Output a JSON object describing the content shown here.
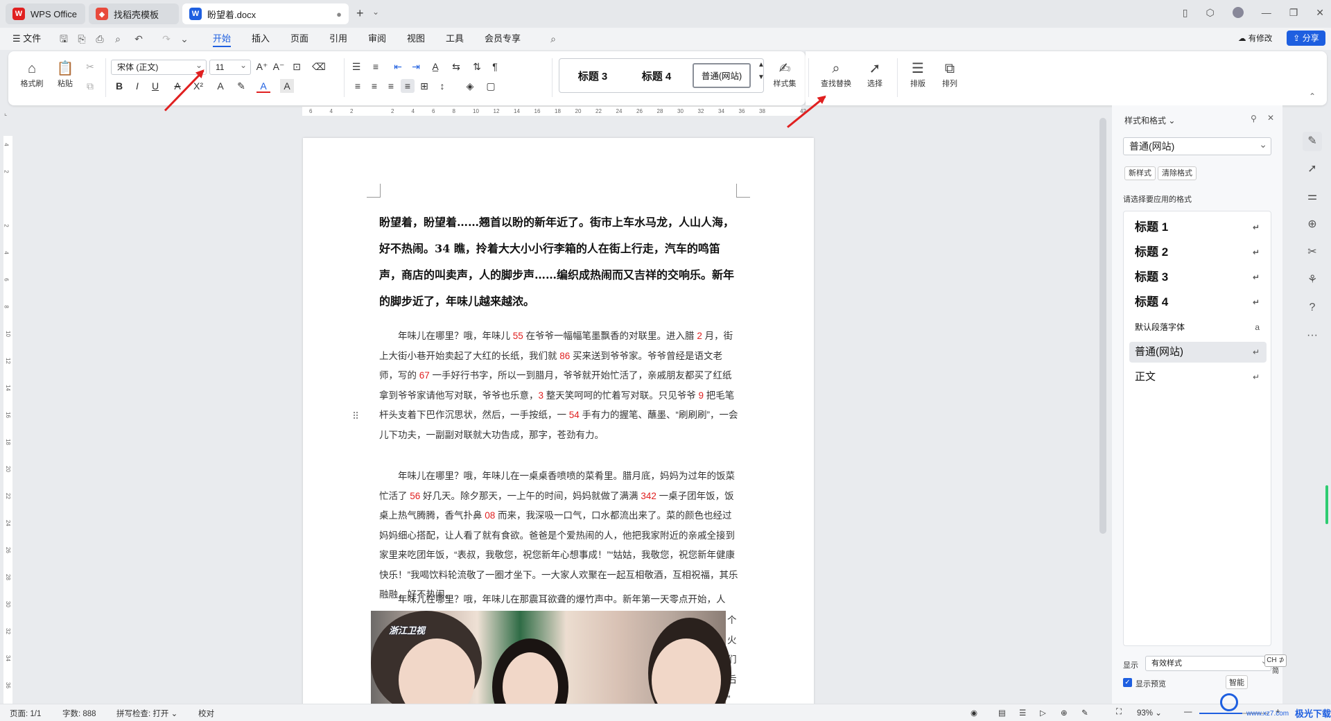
{
  "tabs": [
    {
      "label": "WPS Office",
      "logo": "W"
    },
    {
      "label": "找稻壳模板",
      "logo": "D"
    },
    {
      "label": "盼望着.docx",
      "logo": "W"
    }
  ],
  "menu": {
    "file": "文件",
    "items": [
      "开始",
      "插入",
      "页面",
      "引用",
      "审阅",
      "视图",
      "工具",
      "会员专享"
    ],
    "active": "开始",
    "right_modified": "有修改",
    "right_share": "分享"
  },
  "ribbon": {
    "format_painter": "格式刷",
    "paste": "粘贴",
    "font_name": "宋体 (正文)",
    "font_size": "11",
    "styles": [
      "标题 3",
      "标题 4",
      "普通(网站)"
    ],
    "style_set": "样式集",
    "find_replace": "查找替换",
    "select": "选择",
    "layout": "排版",
    "arrange": "排列"
  },
  "hruler_ticks": [
    "6",
    "4",
    "2",
    "",
    "2",
    "4",
    "6",
    "8",
    "10",
    "12",
    "14",
    "16",
    "18",
    "20",
    "22",
    "24",
    "26",
    "28",
    "30",
    "32",
    "34",
    "36",
    "38",
    "",
    "42"
  ],
  "vruler_ticks": [
    "4",
    "2",
    "",
    "2",
    "4",
    "6",
    "8",
    "10",
    "12",
    "14",
    "16",
    "18",
    "20",
    "22",
    "24",
    "26",
    "28",
    "30",
    "32",
    "34",
    "36"
  ],
  "document": {
    "heading": "盼望着，盼望着……翘首以盼的新年近了。街市上车水马龙，人山人海，好不热闹。34 瞧，拎着大大小小行李箱的人在街上行走，汽车的鸣笛声，商店的叫卖声，人的脚步声……编织成热闹而又吉祥的交响乐。新年的脚步近了，年味儿越来越浓。",
    "p1": [
      "年味儿在哪里？哦，年味儿 ",
      "55",
      " 在爷爷一幅幅笔墨飘香的对联里。进入腊 ",
      "2",
      " 月，街上大街小巷开始卖起了大红的长纸，我们就 ",
      "86",
      " 买来送到爷爷家。爷爷曾经是语文老师，写的 ",
      "67",
      " 一手好行书字，所以一到腊月，爷爷就开始忙活了，亲戚朋友都买了红纸拿到爷爷家请他写对联，爷爷也乐意，",
      "3",
      " 整天笑呵呵的忙着写对联。只见爷爷 ",
      "9",
      " 把毛笔杆头支着下巴作沉思状，然后，一手按纸，一 ",
      "54",
      " 手有力的握笔、蘸墨、“刷刷刷”，一会儿下功夫，一副副对联就大功告成，那字，苍劲有力。"
    ],
    "p2": [
      "年味儿在哪里？哦，年味儿在一桌桌香喷喷的菜肴里。腊月底，妈妈为过年的饭菜忙活了 ",
      "56",
      " 好几天。除夕那天，一上午的时间，妈妈就做了满满 ",
      "342",
      " 一桌子团年饭，饭桌上热气腾腾，香气扑鼻 ",
      "08",
      " 而来，我深吸一口气，口水都流出来了。菜的颜色也经过妈妈细心搭配，让人看了就有食欲。爸爸是个爱热闹的人，他把我家附近的亲戚全接到家里来吃团年饭，“表叔，我敬您，祝您新年心想事成！”“姑姑，我敬您，祝您新年健康快乐！”我喝饮料轮流敬了一圈才坐下。一大家人欢聚在一起互相敬酒，互相祝福，其乐融融，好不热闹。"
    ],
    "p3": "年味儿在哪里？哦，年味儿在那震耳欲聋的爆竹声中。新年第一天零点开始，人",
    "wrap_chars": [
      "个",
      "火",
      "们",
      "后",
      "”"
    ],
    "photo_logo": "浙江卫视"
  },
  "sidebar": {
    "title": "样式和格式",
    "current": "普通(网站)",
    "new_style": "新样式",
    "clear_format": "清除格式",
    "prompt": "请选择要应用的格式",
    "styles": [
      {
        "label": "标题 1",
        "ret": "↵"
      },
      {
        "label": "标题 2",
        "ret": "↵"
      },
      {
        "label": "标题 3",
        "ret": "↵"
      },
      {
        "label": "标题 4",
        "ret": "↵"
      },
      {
        "label": "默认段落字体",
        "ret": "a"
      },
      {
        "label": "普通(网站)",
        "ret": "↵"
      },
      {
        "label": "正文",
        "ret": "↵"
      }
    ],
    "show_label": "显示",
    "show_value": "有效样式",
    "preview_label": "显示预览",
    "ime": "CH ⊅ 简",
    "smart": "智能"
  },
  "status": {
    "page": "页面: 1/1",
    "words": "字数: 888",
    "spell": "拼写检查: 打开",
    "proof": "校对",
    "zoom": "93%"
  },
  "watermark": "极光下载站",
  "watermark_url": "www.xz7.com",
  "colors": {
    "accent": "#1e5fe0",
    "arrow": "#e02020",
    "number": "#e02020"
  }
}
